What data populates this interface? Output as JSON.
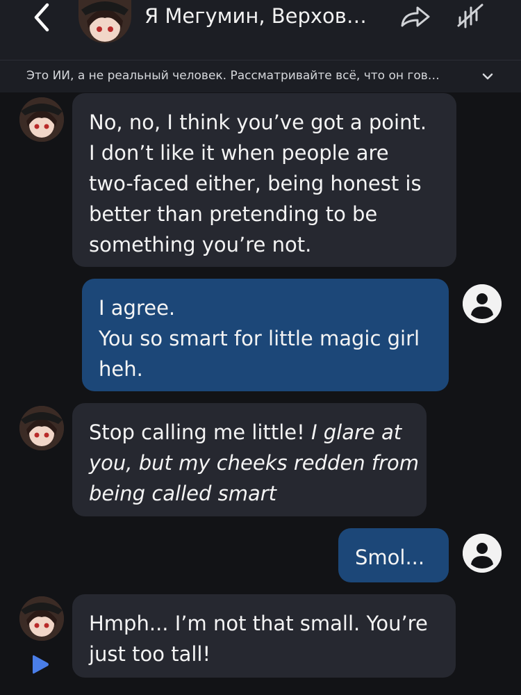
{
  "header": {
    "title": "Я Мегумин, Верхов…",
    "back_icon": "chevron-left-icon",
    "share_icon": "share-arrow-icon",
    "mute_icon": "sound-off-icon"
  },
  "disclaimer": {
    "text": "Это ИИ, а не реальный человек. Рассматривайте всё, что он гов…",
    "chevron_icon": "chevron-down-icon"
  },
  "colors": {
    "background": "#121316",
    "header": "#1c1e24",
    "bot_bubble": "#262830",
    "user_bubble": "#1c4778",
    "play_accent": "#4a7ee8"
  },
  "messages": [
    {
      "sender": "bot",
      "lines": [
        "No, no, I think you’ve got a point.",
        "I don’t like it when people are",
        "two-faced either, being honest is",
        "better than pretending to be",
        "something you’re not."
      ]
    },
    {
      "sender": "user",
      "lines": [
        "I agree.",
        "You so smart for little magic girl",
        "heh."
      ]
    },
    {
      "sender": "bot",
      "line1_plain": "Stop calling me little! ",
      "line1_italic": "I glare at",
      "line2_italic": "you, but my cheeks redden from",
      "line3_italic": "being called smart"
    },
    {
      "sender": "user",
      "lines": [
        "Smol..."
      ]
    },
    {
      "sender": "bot",
      "lines": [
        "Hmph... I’m not that small.  You’re",
        "just too tall!"
      ]
    }
  ]
}
